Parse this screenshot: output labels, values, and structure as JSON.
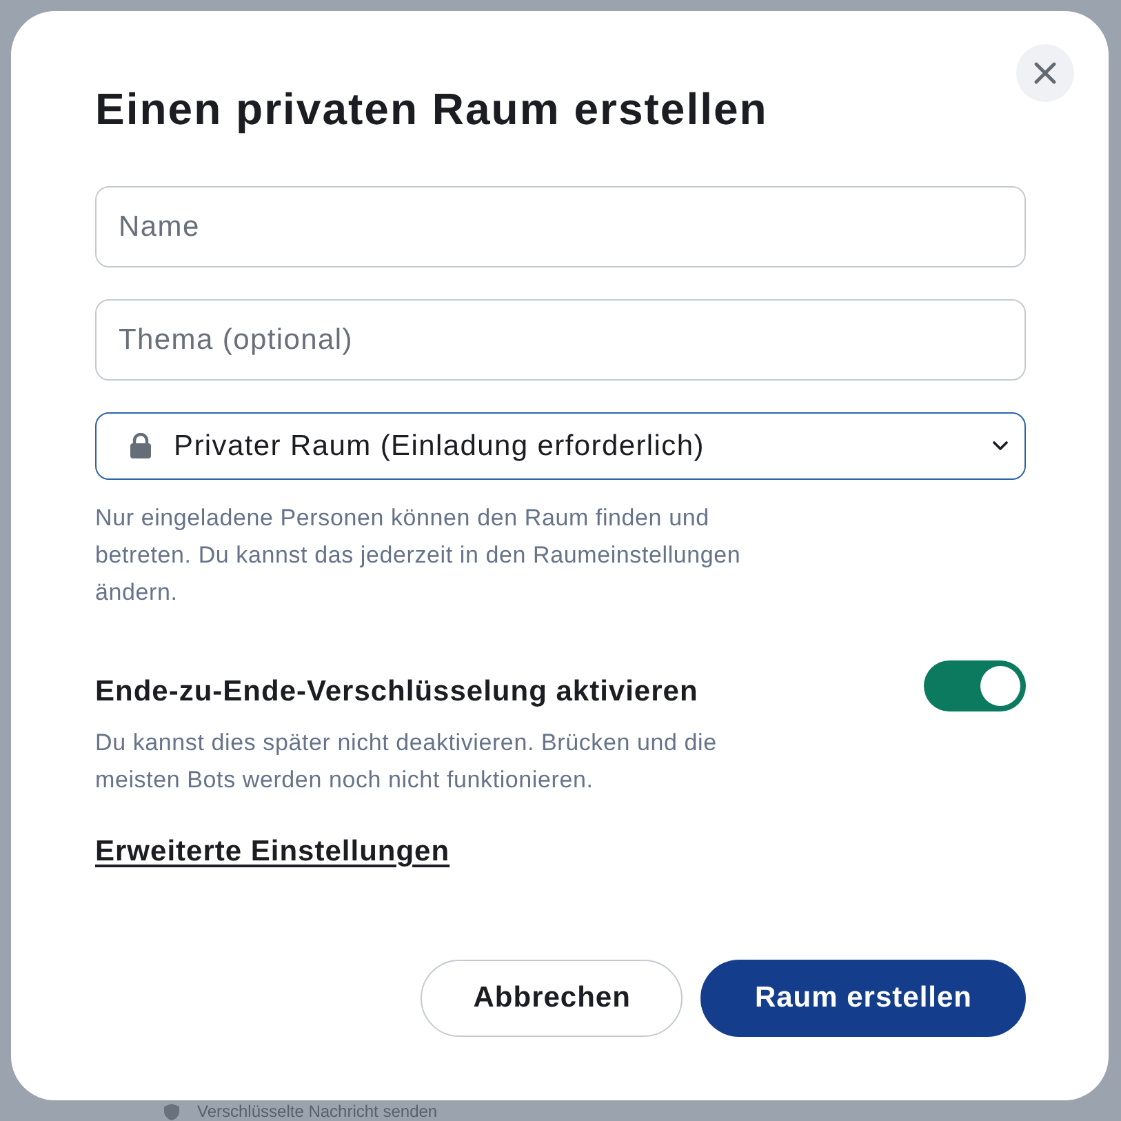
{
  "background": {
    "composer": {
      "placeholder": "Verschlüsselte Nachricht senden"
    }
  },
  "dialog": {
    "title": "Einen privaten Raum erstellen",
    "fields": [
      {
        "kind": "text",
        "placeholder": "Name",
        "focused": false
      },
      {
        "kind": "text",
        "placeholder": "Thema (optional)",
        "focused": false
      },
      {
        "kind": "select",
        "value": "Privater Raum (Einladung erforderlich)",
        "focused": true
      }
    ],
    "join_rule_help": "Nur eingeladene Personen können den Raum finden und betreten. Du kannst das jederzeit in den Raumeinstellungen ändern.",
    "encryption": {
      "label": "Ende-zu-Ende-Verschlüsselung aktivieren",
      "description": "Du kannst dies später nicht deaktivieren. Brücken und die meisten Bots werden noch nicht funktionieren.",
      "on": true
    },
    "advanced_link": "Erweiterte Einstellungen",
    "buttons": [
      {
        "label": "Abbrechen",
        "kind": "secondary"
      },
      {
        "label": "Raum erstellen",
        "kind": "primary"
      }
    ]
  }
}
